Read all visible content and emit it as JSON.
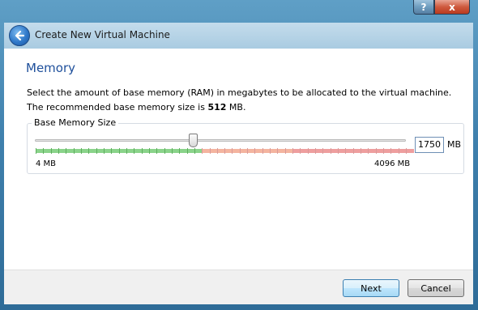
{
  "window": {
    "help_label": "?",
    "close_label": "x"
  },
  "header": {
    "title": "Create New Virtual Machine",
    "back_icon": "back-arrow-icon"
  },
  "page": {
    "title": "Memory",
    "description": "Select the amount of base memory (RAM) in megabytes to be allocated to the virtual machine.",
    "recommended_prefix": "The recommended base memory size is ",
    "recommended_value": "512",
    "recommended_suffix": " MB."
  },
  "memory": {
    "group_label": "Base Memory Size",
    "value": "1750",
    "unit": "MB",
    "min_label": "4 MB",
    "max_label": "4096 MB",
    "slider_min": 4,
    "slider_max": 4096,
    "slider_value": 1750,
    "recommended_max_fraction": 0.43,
    "caution_end_fraction": 0.69,
    "colors": {
      "ok": "#8ad38a",
      "warn": "#f4b49f",
      "bad": "#ee9e9e"
    }
  },
  "footer": {
    "next_label": "Next",
    "cancel_label": "Cancel"
  }
}
